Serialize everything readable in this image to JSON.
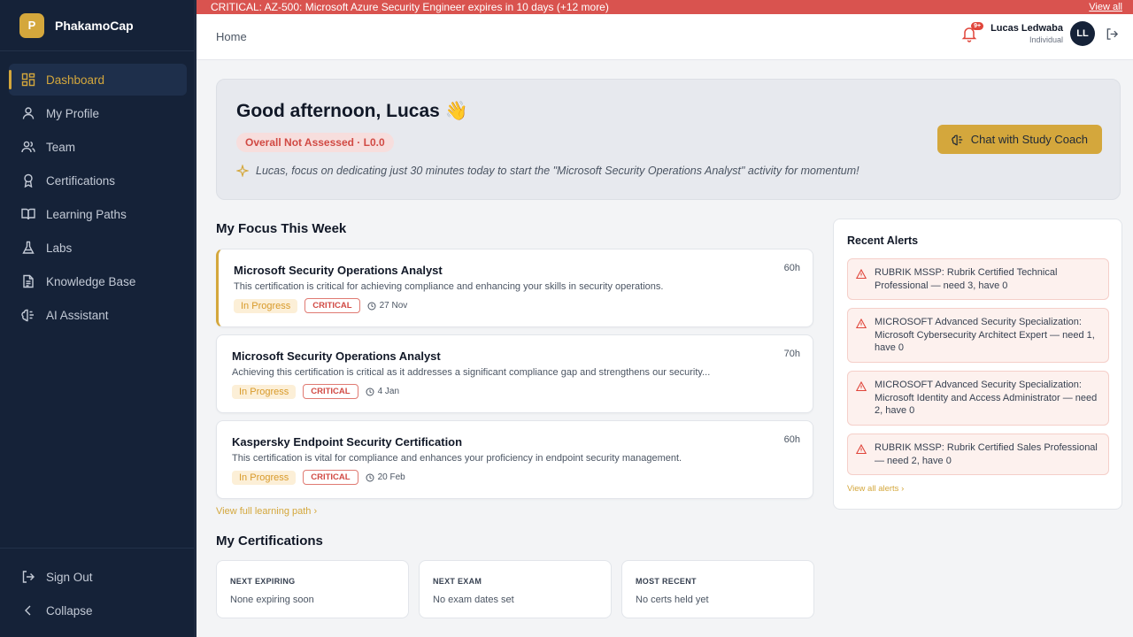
{
  "app": {
    "logo_letter": "P",
    "name": "PhakamoCap"
  },
  "banner": {
    "text": "CRITICAL: AZ-500: Microsoft Azure Security Engineer expires in 10 days (+12 more)",
    "view_all": "View all"
  },
  "sidebar": {
    "items": [
      {
        "label": "Dashboard",
        "icon": "grid-icon",
        "active": true
      },
      {
        "label": "My Profile",
        "icon": "user-icon"
      },
      {
        "label": "Team",
        "icon": "users-icon"
      },
      {
        "label": "Certifications",
        "icon": "award-icon"
      },
      {
        "label": "Learning Paths",
        "icon": "book-icon"
      },
      {
        "label": "Labs",
        "icon": "flask-icon"
      },
      {
        "label": "Knowledge Base",
        "icon": "document-icon"
      },
      {
        "label": "AI Assistant",
        "icon": "brain-icon"
      }
    ],
    "sign_out": "Sign Out",
    "collapse": "Collapse"
  },
  "header": {
    "breadcrumb": "Home",
    "notif_count": "9+",
    "user_name": "Lucas Ledwaba",
    "user_role": "Individual",
    "avatar_initials": "LL"
  },
  "hero": {
    "greeting": "Good afternoon, Lucas 👋",
    "status_pill": "Overall Not Assessed · L0.0",
    "tip": "Lucas, focus on dedicating just 30 minutes today to start the \"Microsoft Security Operations Analyst\" activity for momentum!",
    "coach_button": "Chat with Study Coach"
  },
  "focus": {
    "title": "My Focus This Week",
    "items": [
      {
        "title": "Microsoft Security Operations Analyst",
        "desc": "This certification is critical for achieving compliance and enhancing your skills in security operations.",
        "hours": "60h",
        "status": "In Progress",
        "priority": "CRITICAL",
        "date": "27 Nov"
      },
      {
        "title": "Microsoft Security Operations Analyst",
        "desc": "Achieving this certification is critical as it addresses a significant compliance gap and strengthens our security...",
        "hours": "70h",
        "status": "In Progress",
        "priority": "CRITICAL",
        "date": "4 Jan"
      },
      {
        "title": "Kaspersky Endpoint Security Certification",
        "desc": "This certification is vital for compliance and enhances your proficiency in endpoint security management.",
        "hours": "60h",
        "status": "In Progress",
        "priority": "CRITICAL",
        "date": "20 Feb"
      }
    ],
    "view_link": "View full learning path  ›"
  },
  "alerts": {
    "title": "Recent Alerts",
    "items": [
      "RUBRIK MSSP: Rubrik Certified Technical Professional — need 3, have 0",
      "MICROSOFT Advanced Security Specialization: Microsoft Cybersecurity Architect Expert — need 1, have 0",
      "MICROSOFT Advanced Security Specialization: Microsoft Identity and Access Administrator — need 2, have 0",
      "RUBRIK MSSP: Rubrik Certified Sales Professional — need 2, have 0"
    ],
    "view_link": "View all alerts  ›"
  },
  "certs": {
    "title": "My Certifications",
    "cards": [
      {
        "label": "NEXT EXPIRING",
        "value": "None expiring soon"
      },
      {
        "label": "NEXT EXAM",
        "value": "No exam dates set"
      },
      {
        "label": "MOST RECENT",
        "value": "No certs held yet"
      }
    ]
  },
  "colors": {
    "accent": "#d4a73c",
    "sidebar": "#152238",
    "critical": "#d14a44",
    "banner": "#d9534f"
  }
}
